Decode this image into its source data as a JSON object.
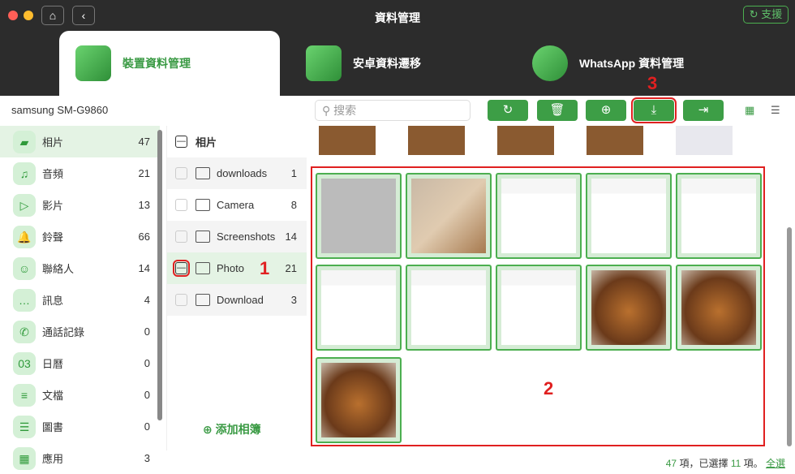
{
  "window": {
    "title": "資料管理",
    "support": "支援"
  },
  "tabs": [
    {
      "label": "裝置資料管理"
    },
    {
      "label": "安卓資料遷移"
    },
    {
      "label": "WhatsApp 資料管理"
    }
  ],
  "device": "samsung SM-G9860",
  "search": {
    "placeholder": "搜索"
  },
  "toolbar": [
    "refresh-icon",
    "delete-icon",
    "add-icon",
    "export-to-pc-icon",
    "import-icon"
  ],
  "annotations": {
    "one": "1",
    "two": "2",
    "three": "3"
  },
  "sidebar": [
    {
      "label": "相片",
      "count": "47",
      "icon": "▰"
    },
    {
      "label": "音頻",
      "count": "21",
      "icon": "♫"
    },
    {
      "label": "影片",
      "count": "13",
      "icon": "▷"
    },
    {
      "label": "鈴聲",
      "count": "66",
      "icon": "🔔"
    },
    {
      "label": "聯絡人",
      "count": "14",
      "icon": "☺"
    },
    {
      "label": "訊息",
      "count": "4",
      "icon": "…"
    },
    {
      "label": "通話記錄",
      "count": "0",
      "icon": "✆"
    },
    {
      "label": "日曆",
      "count": "0",
      "icon": "03"
    },
    {
      "label": "文檔",
      "count": "0",
      "icon": "≡"
    },
    {
      "label": "圖書",
      "count": "0",
      "icon": "☰"
    },
    {
      "label": "應用",
      "count": "3",
      "icon": "▦"
    }
  ],
  "albums": {
    "header": "相片",
    "items": [
      {
        "label": "downloads",
        "count": "1"
      },
      {
        "label": "Camera",
        "count": "8"
      },
      {
        "label": "Screenshots",
        "count": "14"
      },
      {
        "label": "Photo",
        "count": "21"
      },
      {
        "label": "Download",
        "count": "3"
      }
    ],
    "add": "添加相簿"
  },
  "grid": {
    "thumbs": [
      "screenshot",
      "dog",
      "screenshot",
      "screenshot",
      "screenshot",
      "screenshot",
      "screenshot",
      "screenshot",
      "food",
      "food",
      "food"
    ]
  },
  "footer": {
    "total": "47",
    "total_unit": "項，已選擇",
    "selected": "11",
    "selected_unit": "項。",
    "select_all": "全選"
  }
}
